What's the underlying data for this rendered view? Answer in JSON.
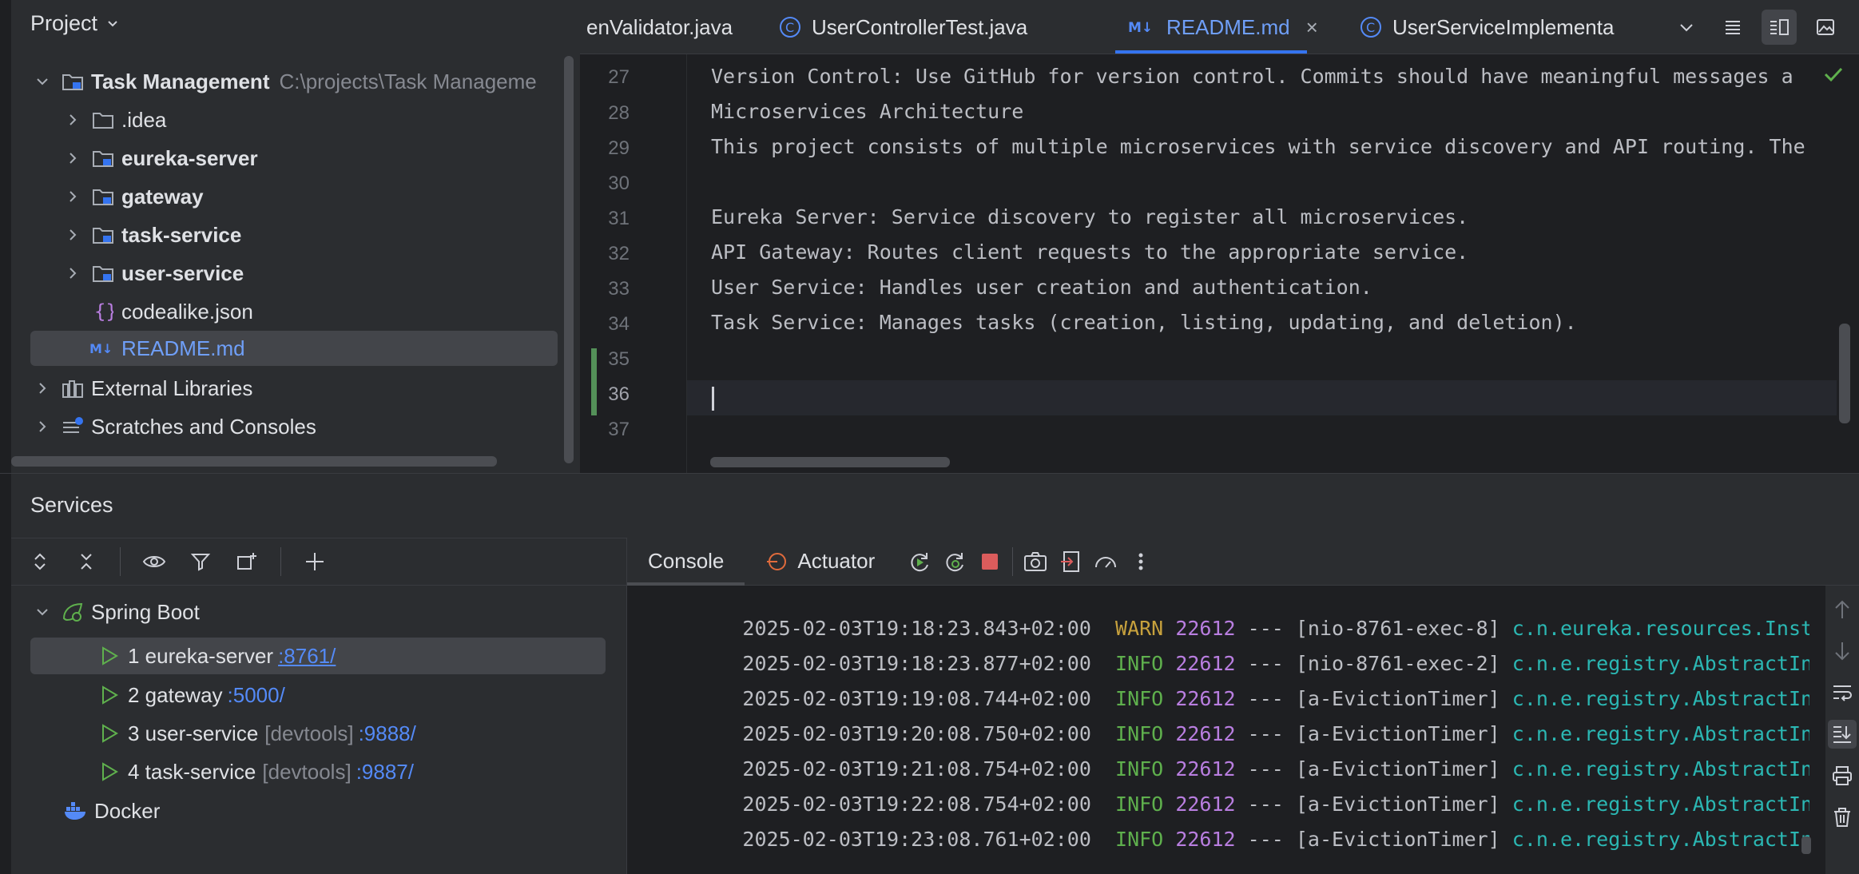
{
  "project_panel": {
    "title": "Project",
    "tree": [
      {
        "label": "Task Management",
        "path": "C:\\projects\\Task Manageme",
        "icon": "module-folder-icon"
      },
      {
        "label": ".idea",
        "icon": "folder-icon"
      },
      {
        "label": "eureka-server",
        "icon": "module-folder-icon"
      },
      {
        "label": "gateway",
        "icon": "module-folder-icon"
      },
      {
        "label": "task-service",
        "icon": "module-folder-icon"
      },
      {
        "label": "user-service",
        "icon": "module-folder-icon"
      },
      {
        "label": "codealike.json",
        "icon": "json-file-icon"
      },
      {
        "label": "README.md",
        "icon": "markdown-file-icon"
      },
      {
        "label": "External Libraries",
        "icon": "libraries-icon"
      },
      {
        "label": "Scratches and Consoles",
        "icon": "scratches-icon"
      }
    ]
  },
  "editor": {
    "tabs": [
      {
        "label": "enValidator.java",
        "active": false
      },
      {
        "label": "UserControllerTest.java",
        "active": false
      },
      {
        "label": "README.md",
        "active": true
      },
      {
        "label": "UserServiceImplementa",
        "active": false
      }
    ],
    "close_symbol": "×",
    "lines": [
      {
        "num": "27",
        "text": "Version Control: Use GitHub for version control. Commits should have meaningful messages a"
      },
      {
        "num": "28",
        "text": "Microservices Architecture"
      },
      {
        "num": "29",
        "text": "This project consists of multiple microservices with service discovery and API routing. The"
      },
      {
        "num": "30",
        "text": ""
      },
      {
        "num": "31",
        "text": "Eureka Server: Service discovery to register all microservices."
      },
      {
        "num": "32",
        "text": "API Gateway: Routes client requests to the appropriate service."
      },
      {
        "num": "33",
        "text": "User Service: Handles user creation and authentication."
      },
      {
        "num": "34",
        "text": "Task Service: Manages tasks (creation, listing, updating, and deletion)."
      },
      {
        "num": "35",
        "text": ""
      },
      {
        "num": "36",
        "text": ""
      },
      {
        "num": "37",
        "text": ""
      }
    ]
  },
  "services": {
    "title": "Services",
    "tree": {
      "root": "Spring Boot",
      "items": [
        {
          "label": "1 eureka-server",
          "devtools": "",
          "port": ":8761/"
        },
        {
          "label": "2 gateway",
          "devtools": "",
          "port": ":5000/"
        },
        {
          "label": "3 user-service",
          "devtools": "[devtools]",
          "port": ":9888/"
        },
        {
          "label": "4 task-service",
          "devtools": "[devtools]",
          "port": ":9887/"
        }
      ],
      "docker": "Docker"
    },
    "console_tabs": {
      "console": "Console",
      "actuator": "Actuator"
    },
    "log": [
      {
        "ts": "2025-02-03T19:18:23.843+02:00",
        "level": "WARN",
        "pid": "22612",
        "sep": "---",
        "thread": "[nio-8761-exec-8]",
        "logger": "c.n.eureka.resources.Instanc"
      },
      {
        "ts": "2025-02-03T19:18:23.877+02:00",
        "level": "INFO",
        "pid": "22612",
        "sep": "---",
        "thread": "[nio-8761-exec-2]",
        "logger": "c.n.e.registry.AbstractInsta"
      },
      {
        "ts": "2025-02-03T19:19:08.744+02:00",
        "level": "INFO",
        "pid": "22612",
        "sep": "---",
        "thread": "[a-EvictionTimer]",
        "logger": "c.n.e.registry.AbstractInsta"
      },
      {
        "ts": "2025-02-03T19:20:08.750+02:00",
        "level": "INFO",
        "pid": "22612",
        "sep": "---",
        "thread": "[a-EvictionTimer]",
        "logger": "c.n.e.registry.AbstractInsta"
      },
      {
        "ts": "2025-02-03T19:21:08.754+02:00",
        "level": "INFO",
        "pid": "22612",
        "sep": "---",
        "thread": "[a-EvictionTimer]",
        "logger": "c.n.e.registry.AbstractInsta"
      },
      {
        "ts": "2025-02-03T19:22:08.754+02:00",
        "level": "INFO",
        "pid": "22612",
        "sep": "---",
        "thread": "[a-EvictionTimer]",
        "logger": "c.n.e.registry.AbstractInsta"
      },
      {
        "ts": "2025-02-03T19:23:08.761+02:00",
        "level": "INFO",
        "pid": "22612",
        "sep": "---",
        "thread": "[a-EvictionTimer]",
        "logger": "c.n.e.registry.AbstractInsta"
      }
    ]
  },
  "colors": {
    "accent": "#3574f0",
    "link": "#548af7",
    "run_green": "#5fb04d",
    "warn": "#c7a13d",
    "pid": "#b97ee0",
    "logger": "#2bb7b3",
    "stop_red": "#db5c5c"
  }
}
